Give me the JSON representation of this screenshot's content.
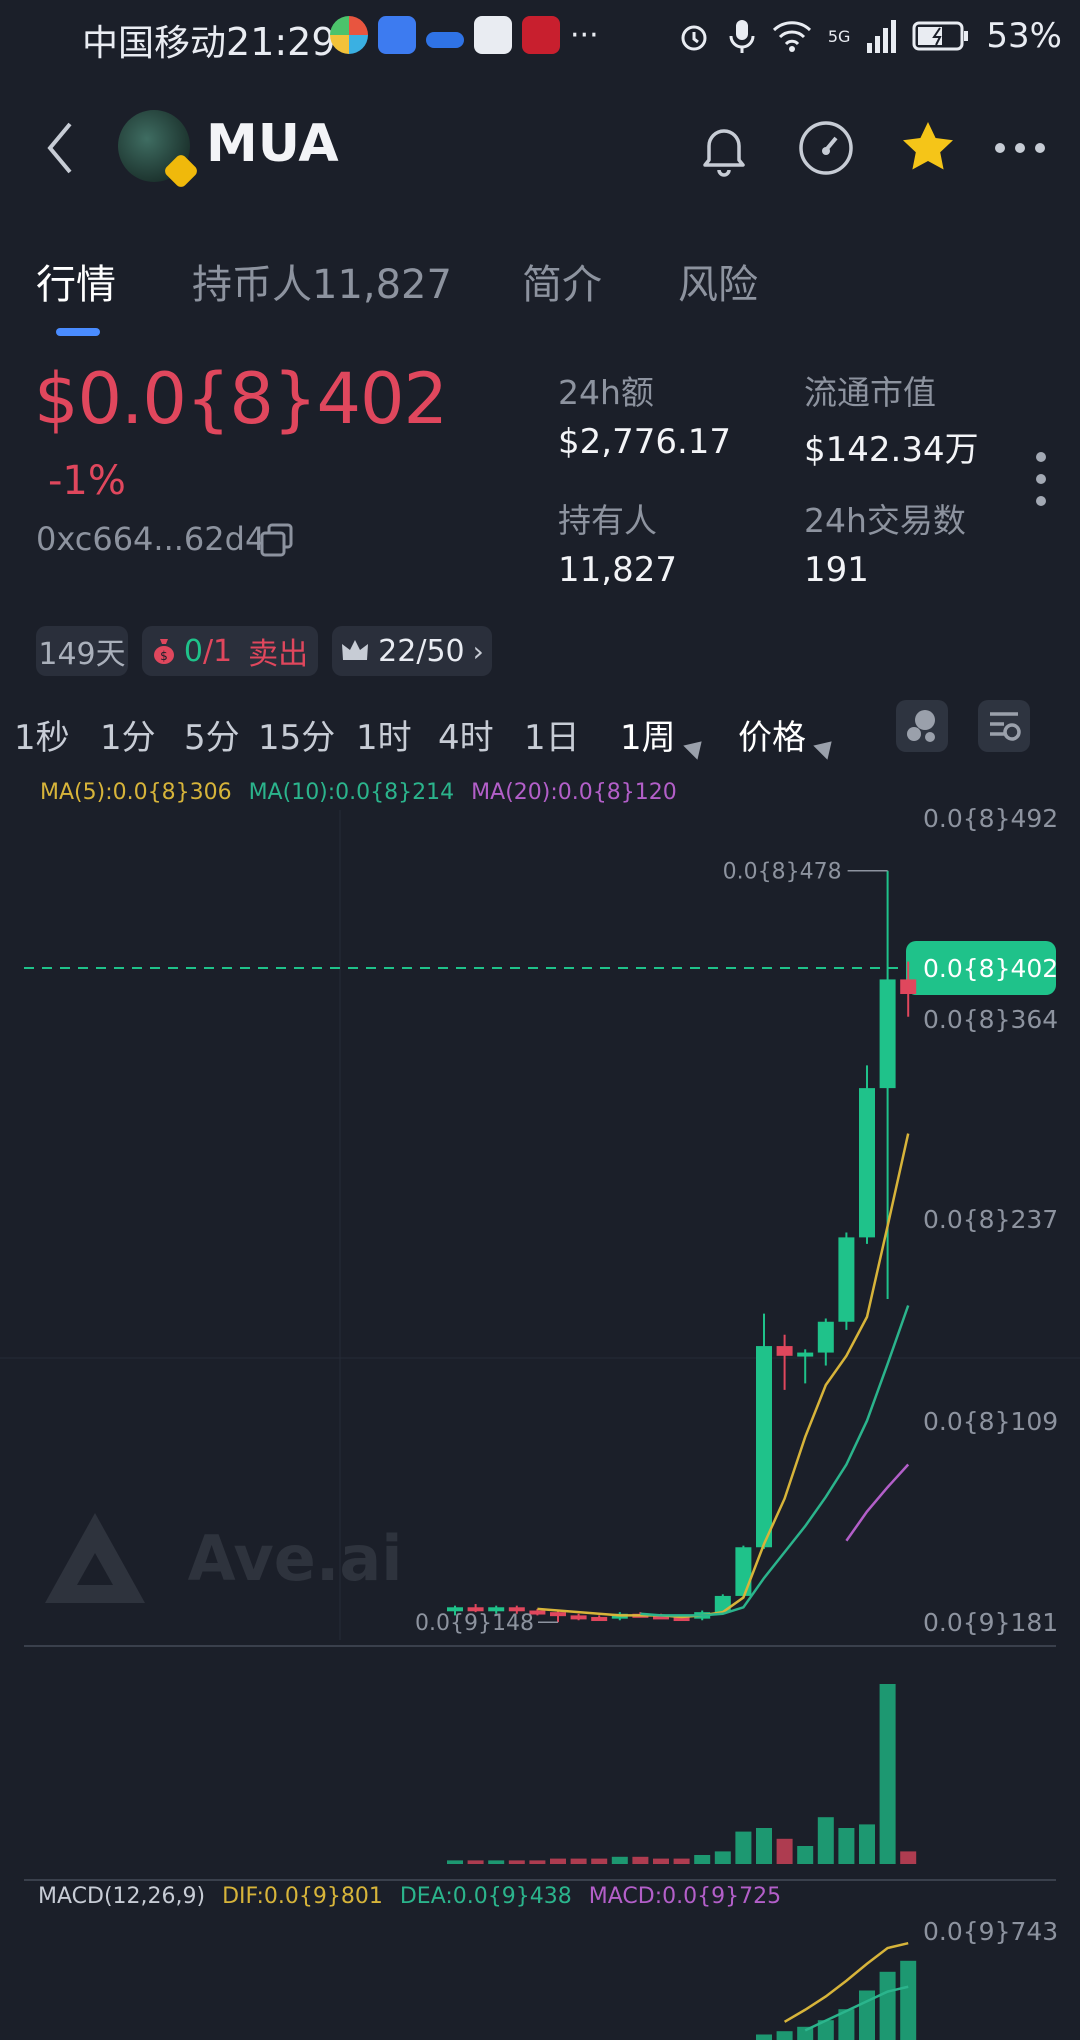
{
  "status_bar": {
    "carrier": "中国移动",
    "time": "21:29",
    "dots": "···",
    "network": "5G",
    "battery": "53%"
  },
  "header": {
    "token_name": "MUA"
  },
  "tabs": [
    {
      "label": "行情",
      "active": true
    },
    {
      "label": "持币人11,827",
      "active": false
    },
    {
      "label": "简介",
      "active": false
    },
    {
      "label": "风险",
      "active": false
    }
  ],
  "price": {
    "value": "$0.0{8}402",
    "change": "-1%",
    "address": "0xc664...62d4"
  },
  "stats": {
    "volume_label": "24h额",
    "volume_value": "$2,776.17",
    "mcap_label": "流通市值",
    "mcap_value": "$142.34万",
    "holders_label": "持有人",
    "holders_value": "11,827",
    "txns_label": "24h交易数",
    "txns_value": "191"
  },
  "pills": {
    "age": "149天",
    "buy_sell_buy": "0",
    "buy_sell_sep": "/1",
    "buy_sell_label": "卖出",
    "rank": "22/50"
  },
  "intervals": [
    "1秒",
    "1分",
    "5分",
    "15分",
    "1时",
    "4时",
    "1日"
  ],
  "selected_interval": "1周",
  "price_mode": "价格",
  "ma": {
    "ma5": "MA(5):0.0{8}306",
    "ma10": "MA(10):0.0{8}214",
    "ma20": "MA(20):0.0{8}120"
  },
  "macd": {
    "title": "MACD(12,26,9)",
    "dif": "DIF:0.0{9}801",
    "dea": "DEA:0.0{9}438",
    "macd": "MACD:0.0{9}725"
  },
  "watermark": "Ave.ai",
  "colors": {
    "up": "#1fc28a",
    "down": "#e0475d",
    "ma5": "#d7b43a",
    "ma10": "#2bb48c",
    "ma20": "#b35fc9",
    "accent": "#4a8cff",
    "star": "#f5c518"
  },
  "chart_data": {
    "type": "candlestick",
    "y_tick_labels": [
      "0.0{8}492",
      "0.0{8}364",
      "0.0{8}237",
      "0.0{8}109",
      "0.0{9}181"
    ],
    "y_ticks": [
      4.92,
      3.64,
      2.37,
      1.09,
      0.181
    ],
    "y_unit": "× 1e-8",
    "last_price_label": "0.0{8}402",
    "last_price": 4.02,
    "max_label": "0.0{8}478",
    "min_label": "0.0{9}148",
    "candles": [
      {
        "o": 0.22,
        "h": 0.25,
        "l": 0.19,
        "c": 0.24
      },
      {
        "o": 0.24,
        "h": 0.26,
        "l": 0.21,
        "c": 0.22
      },
      {
        "o": 0.22,
        "h": 0.25,
        "l": 0.2,
        "c": 0.24
      },
      {
        "o": 0.24,
        "h": 0.25,
        "l": 0.2,
        "c": 0.22
      },
      {
        "o": 0.22,
        "h": 0.23,
        "l": 0.19,
        "c": 0.21
      },
      {
        "o": 0.21,
        "h": 0.22,
        "l": 0.148,
        "c": 0.19
      },
      {
        "o": 0.19,
        "h": 0.2,
        "l": 0.16,
        "c": 0.18
      },
      {
        "o": 0.18,
        "h": 0.19,
        "l": 0.16,
        "c": 0.17
      },
      {
        "o": 0.17,
        "h": 0.21,
        "l": 0.16,
        "c": 0.2
      },
      {
        "o": 0.2,
        "h": 0.21,
        "l": 0.18,
        "c": 0.19
      },
      {
        "o": 0.19,
        "h": 0.2,
        "l": 0.17,
        "c": 0.18
      },
      {
        "o": 0.18,
        "h": 0.19,
        "l": 0.16,
        "c": 0.17
      },
      {
        "o": 0.17,
        "h": 0.22,
        "l": 0.16,
        "c": 0.21
      },
      {
        "o": 0.21,
        "h": 0.32,
        "l": 0.2,
        "c": 0.31
      },
      {
        "o": 0.31,
        "h": 0.62,
        "l": 0.3,
        "c": 0.61
      },
      {
        "o": 0.61,
        "h": 2.05,
        "l": 0.6,
        "c": 1.85
      },
      {
        "o": 1.85,
        "h": 1.92,
        "l": 1.58,
        "c": 1.79
      },
      {
        "o": 1.79,
        "h": 1.83,
        "l": 1.62,
        "c": 1.81
      },
      {
        "o": 1.81,
        "h": 2.02,
        "l": 1.73,
        "c": 2.0
      },
      {
        "o": 2.0,
        "h": 2.55,
        "l": 1.95,
        "c": 2.52
      },
      {
        "o": 2.52,
        "h": 3.58,
        "l": 2.48,
        "c": 3.44
      },
      {
        "o": 3.44,
        "h": 4.78,
        "l": 2.14,
        "c": 4.11
      },
      {
        "o": 4.11,
        "h": 4.22,
        "l": 3.88,
        "c": 4.02
      }
    ],
    "ma5": [
      null,
      null,
      null,
      null,
      0.23,
      0.22,
      0.21,
      0.2,
      0.19,
      0.19,
      0.19,
      0.18,
      0.19,
      0.21,
      0.3,
      0.63,
      0.91,
      1.29,
      1.61,
      1.79,
      2.03,
      2.59,
      3.16
    ],
    "ma10": [
      null,
      null,
      null,
      null,
      null,
      null,
      null,
      null,
      null,
      0.2,
      0.19,
      0.19,
      0.19,
      0.2,
      0.24,
      0.42,
      0.58,
      0.74,
      0.92,
      1.12,
      1.39,
      1.74,
      2.1
    ],
    "ma20": [
      null,
      null,
      null,
      null,
      null,
      null,
      null,
      null,
      null,
      null,
      null,
      null,
      null,
      null,
      null,
      null,
      null,
      null,
      null,
      0.65,
      0.83,
      0.98,
      1.12
    ],
    "volume": [
      0.02,
      0.02,
      0.02,
      0.02,
      0.02,
      0.03,
      0.03,
      0.03,
      0.04,
      0.04,
      0.03,
      0.03,
      0.05,
      0.07,
      0.18,
      0.2,
      0.14,
      0.1,
      0.26,
      0.2,
      0.22,
      1.0,
      0.07
    ],
    "macd_hist": [
      0,
      0,
      0,
      0,
      0,
      0,
      0,
      0,
      0,
      0,
      0,
      0,
      0,
      0,
      0,
      0.05,
      0.08,
      0.12,
      0.18,
      0.28,
      0.45,
      0.62,
      0.72
    ],
    "macd_dif": [
      null,
      null,
      null,
      null,
      null,
      null,
      null,
      null,
      null,
      null,
      null,
      null,
      null,
      null,
      null,
      null,
      0.15,
      0.25,
      0.36,
      0.49,
      0.63,
      0.76,
      0.8
    ],
    "macd_dea": [
      null,
      null,
      null,
      null,
      null,
      null,
      null,
      null,
      null,
      null,
      null,
      null,
      null,
      null,
      null,
      null,
      null,
      0.08,
      0.16,
      0.24,
      0.32,
      0.4,
      0.44
    ],
    "macd_tick_label": "0.0{9}743"
  }
}
